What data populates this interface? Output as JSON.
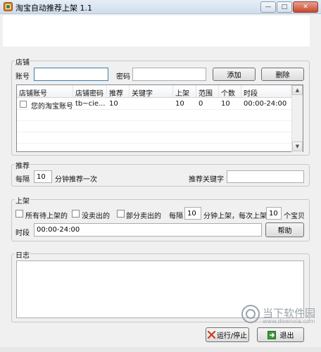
{
  "window": {
    "title": "淘宝自动推荐上架 1.1",
    "minimize_glyph": "—",
    "maximize_glyph": "□",
    "close_glyph": "✕"
  },
  "store": {
    "group_label": "店铺",
    "account_label": "账号",
    "account_value": "",
    "password_label": "密码",
    "password_value": "",
    "add_button": "添加",
    "delete_button": "删除",
    "table": {
      "columns": [
        "店铺账号",
        "店铺密码",
        "推荐",
        "关键字",
        "上架",
        "范围",
        "个数",
        "时段"
      ],
      "rows": [
        {
          "checked": false,
          "cells": [
            "您的淘宝账号",
            "tb~cie...",
            "10",
            "",
            "10",
            "0",
            "10",
            "00:00-24:00"
          ]
        }
      ]
    }
  },
  "recommend": {
    "group_label": "推荐",
    "every_label": "每隔",
    "interval_value": "10",
    "interval_suffix": "分钟推荐一次",
    "keyword_label": "推荐关键字",
    "keyword_value": ""
  },
  "listing": {
    "group_label": "上架",
    "opt_all_label": "所有待上架的",
    "opt_all_checked": false,
    "opt_unsold_label": "没卖出的",
    "opt_unsold_checked": false,
    "opt_partial_label": "部分卖出的",
    "opt_partial_checked": false,
    "every_label": "每隔",
    "interval_value": "10",
    "interval_suffix": "分钟上架，每次上架",
    "count_value": "10",
    "count_suffix": "个宝贝",
    "period_label": "时段",
    "period_value": "00:00-24:00",
    "help_button": "帮助"
  },
  "log": {
    "group_label": "日志",
    "content": ""
  },
  "footer": {
    "run_stop_button": "运行/停止",
    "exit_button": "退出"
  },
  "watermark": {
    "text_main": "当下软件园",
    "text_sub": "www.downxia.com"
  }
}
